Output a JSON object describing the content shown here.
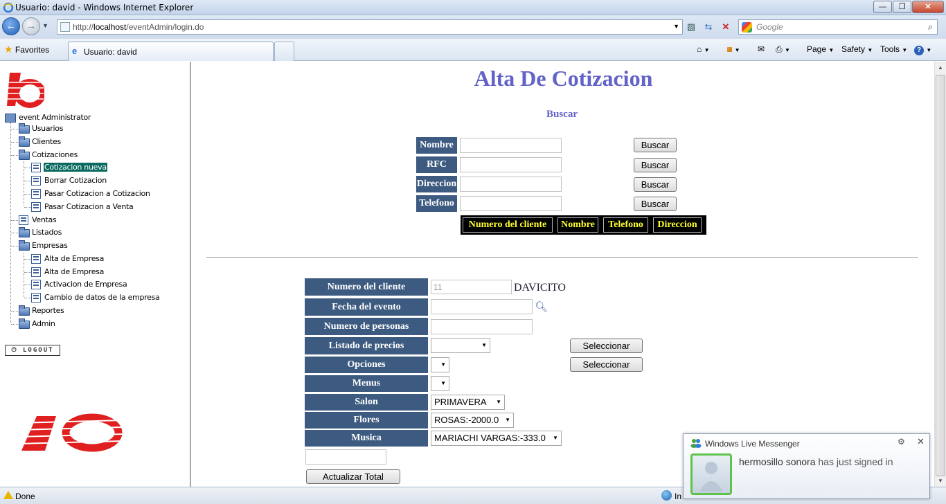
{
  "window": {
    "title": "Usuario: david - Windows Internet Explorer",
    "min_label": "—",
    "max_label": "❐",
    "close_label": "✕"
  },
  "address": {
    "url_prefix": "http://",
    "url_host": "localhost",
    "url_path": "/eventAdmin/login.do",
    "search_placeholder": "Google"
  },
  "favbar": {
    "favorites_label": "Favorites",
    "tab_label": "Usuario: david",
    "page_menu": "Page",
    "safety_menu": "Safety",
    "tools_menu": "Tools",
    "help_menu": "?"
  },
  "sidebar": {
    "root": "event Administrator",
    "items": [
      {
        "label": "Usuarios"
      },
      {
        "label": "Clientes"
      },
      {
        "label": "Cotizaciones"
      },
      {
        "label": "Cotizacion nueva"
      },
      {
        "label": "Borrar Cotizacion"
      },
      {
        "label": "Pasar Cotizacion a Cotizacion"
      },
      {
        "label": "Pasar Cotizacion a Venta"
      },
      {
        "label": "Ventas"
      },
      {
        "label": "Listados"
      },
      {
        "label": "Empresas"
      },
      {
        "label": "Alta de Empresa"
      },
      {
        "label": "Alta de Empresa"
      },
      {
        "label": "Activacion de Empresa"
      },
      {
        "label": "Cambio de datos de la empresa"
      },
      {
        "label": "Reportes"
      },
      {
        "label": "Admin"
      }
    ],
    "logout": "LOGOUT",
    "logo_text": "1o"
  },
  "main": {
    "title": "Alta De Cotizacion",
    "search_heading": "Buscar",
    "search_rows": [
      {
        "label": "Nombre",
        "button": "Buscar"
      },
      {
        "label": "RFC",
        "button": "Buscar"
      },
      {
        "label": "Direccion",
        "button": "Buscar"
      },
      {
        "label": "Telefono",
        "button": "Buscar"
      }
    ],
    "result_headers": [
      "Numero del cliente",
      "Nombre",
      "Telefono",
      "Direccion"
    ],
    "form": {
      "numero_cliente_label": "Numero del cliente",
      "numero_cliente_value": "11",
      "cliente_nombre": "DAVICITO",
      "fecha_label": "Fecha del evento",
      "personas_label": "Numero de personas",
      "precios_label": "Listado de precios",
      "opciones_label": "Opciones",
      "menus_label": "Menus",
      "salon_label": "Salon",
      "salon_value": "PRIMAVERA",
      "flores_label": "Flores",
      "flores_value": "ROSAS:-2000.0",
      "musica_label": "Musica",
      "musica_value": "MARIACHI VARGAS:-333.0",
      "seleccionar_label": "Seleccionar",
      "actualizar_label": "Actualizar Total"
    }
  },
  "statusbar": {
    "status": "Done",
    "zone": "In"
  },
  "messenger": {
    "title": "Windows Live Messenger",
    "contact": "hermosillo sonora",
    "message": "has just signed in"
  }
}
